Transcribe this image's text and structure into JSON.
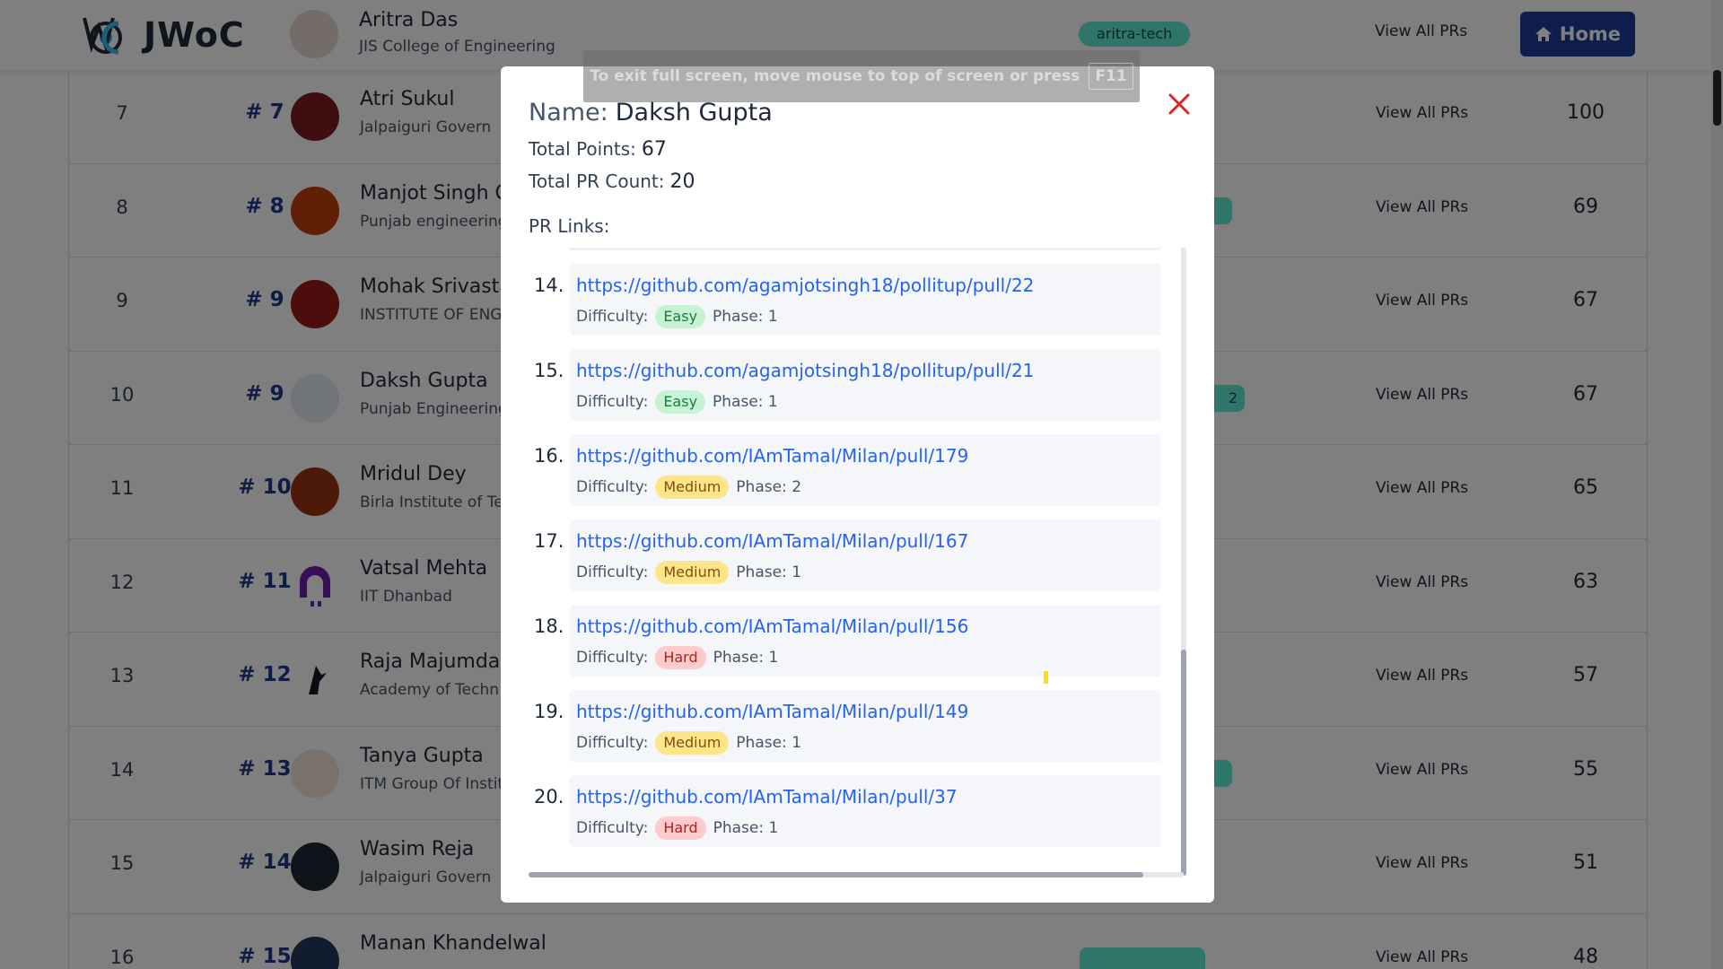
{
  "header": {
    "logo_text": "JWoC",
    "home_label": "Home",
    "partial_row": {
      "name": "Aritra Das",
      "college": "JIS College of Engineering",
      "tag": "aritra-tech",
      "view_all": "View All PRs"
    }
  },
  "rows": [
    {
      "sno": "7",
      "rank": "# 7",
      "name": "Atri Sukul",
      "college": "Jalpaiguri Govern",
      "view_all": "View All PRs",
      "points": "100"
    },
    {
      "sno": "8",
      "rank": "# 8",
      "name": "Manjot Singh O",
      "college": "Punjab engineering",
      "view_all": "View All PRs",
      "points": "69"
    },
    {
      "sno": "9",
      "rank": "# 9",
      "name": "Mohak Srivasta",
      "college": "INSTITUTE OF ENG",
      "view_all": "View All PRs",
      "points": "67"
    },
    {
      "sno": "10",
      "rank": "# 9",
      "name": "Daksh Gupta",
      "college": "Punjab Engineering",
      "tag": "2",
      "view_all": "View All PRs",
      "points": "67"
    },
    {
      "sno": "11",
      "rank": "# 10",
      "name": "Mridul Dey",
      "college": "Birla Institute of Te",
      "view_all": "View All PRs",
      "points": "65"
    },
    {
      "sno": "12",
      "rank": "# 11",
      "name": "Vatsal Mehta",
      "college": "IIT Dhanbad",
      "view_all": "View All PRs",
      "points": "63"
    },
    {
      "sno": "13",
      "rank": "# 12",
      "name": "Raja Majumdar",
      "college": "Academy of Techn",
      "view_all": "View All PRs",
      "points": "57"
    },
    {
      "sno": "14",
      "rank": "# 13",
      "name": "Tanya Gupta",
      "college": "ITM Group Of Instit",
      "view_all": "View All PRs",
      "points": "55"
    },
    {
      "sno": "15",
      "rank": "# 14",
      "name": "Wasim Reja",
      "college": "Jalpaiguri Govern",
      "view_all": "View All PRs",
      "points": "51"
    },
    {
      "sno": "16",
      "rank": "# 15",
      "name": "Manan Khandelwal",
      "college": "",
      "view_all": "View All PRs",
      "points": "48"
    }
  ],
  "toast": {
    "text": "To exit full screen, move mouse to top of screen or press",
    "key": "F11"
  },
  "modal": {
    "name_label": "Name:",
    "name_value": "Daksh Gupta",
    "points_label": "Total Points:",
    "points_value": "67",
    "count_label": "Total PR Count:",
    "count_value": "20",
    "links_label": "PR Links:",
    "difficulty_label": "Difficulty:",
    "prs": [
      {
        "num": "14.",
        "url": "https://github.com/agamjotsingh18/pollitup/pull/22",
        "difficulty": "Easy",
        "level": "easy",
        "phase": "Phase: 1"
      },
      {
        "num": "15.",
        "url": "https://github.com/agamjotsingh18/pollitup/pull/21",
        "difficulty": "Easy",
        "level": "easy",
        "phase": "Phase: 1"
      },
      {
        "num": "16.",
        "url": "https://github.com/IAmTamal/Milan/pull/179",
        "difficulty": "Medium",
        "level": "medium",
        "phase": "Phase: 2"
      },
      {
        "num": "17.",
        "url": "https://github.com/IAmTamal/Milan/pull/167",
        "difficulty": "Medium",
        "level": "medium",
        "phase": "Phase: 1"
      },
      {
        "num": "18.",
        "url": "https://github.com/IAmTamal/Milan/pull/156",
        "difficulty": "Hard",
        "level": "hard",
        "phase": "Phase: 1"
      },
      {
        "num": "19.",
        "url": "https://github.com/IAmTamal/Milan/pull/149",
        "difficulty": "Medium",
        "level": "medium",
        "phase": "Phase: 1"
      },
      {
        "num": "20.",
        "url": "https://github.com/IAmTamal/Milan/pull/37",
        "difficulty": "Hard",
        "level": "hard",
        "phase": "Phase: 1"
      }
    ]
  },
  "colors": {
    "accent": "#1e3a9a",
    "link": "#2563eb",
    "close": "#dc2626"
  }
}
